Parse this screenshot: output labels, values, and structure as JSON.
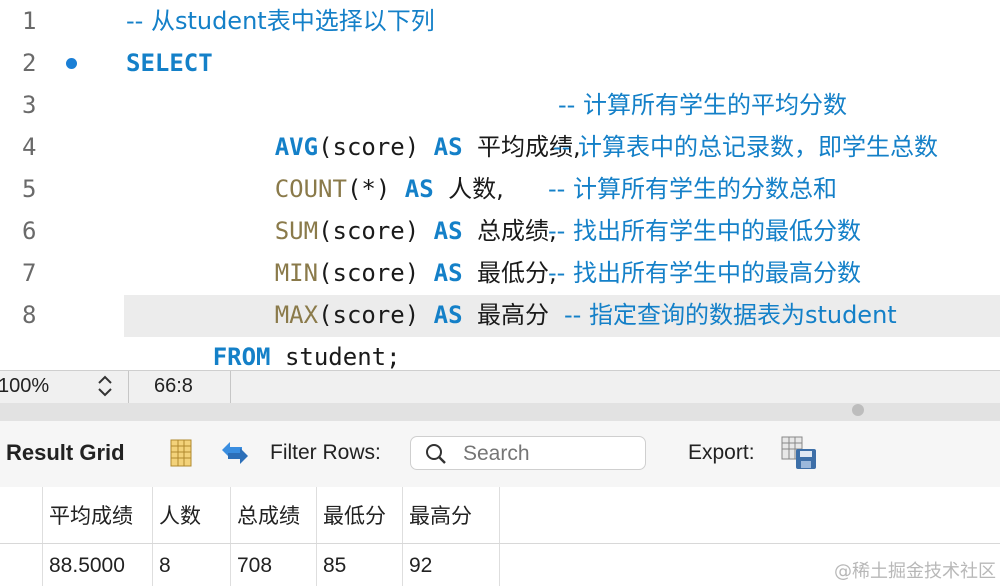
{
  "editor": {
    "lines": [
      {
        "num": "1",
        "comment": "-- 从student表中选择以下列"
      },
      {
        "num": "2",
        "kw": "SELECT"
      },
      {
        "num": "3",
        "fn": "AVG",
        "args": "(score)",
        "as": "AS",
        "alias": "平均成绩,",
        "comment": "-- 计算所有学生的平均分数"
      },
      {
        "num": "4",
        "fn": "COUNT",
        "args": "(*)",
        "as": "AS",
        "alias": "人数,",
        "comment": "-- 计算表中的总记录数，即学生总数"
      },
      {
        "num": "5",
        "fn": "SUM",
        "args": "(score)",
        "as": "AS",
        "alias": "总成绩,",
        "comment": "-- 计算所有学生的分数总和"
      },
      {
        "num": "6",
        "fn": "MIN",
        "args": "(score)",
        "as": "AS",
        "alias": "最低分,",
        "comment": "-- 找出所有学生中的最低分数"
      },
      {
        "num": "7",
        "fn": "MAX",
        "args": "(score)",
        "as": "AS",
        "alias": "最高分",
        "comment": "-- 找出所有学生中的最高分数"
      },
      {
        "num": "8",
        "kw": "FROM",
        "rest": " student;",
        "comment": "-- 指定查询的数据表为student"
      }
    ]
  },
  "statusbar": {
    "zoom": "100%",
    "cursor_pos": "66:8"
  },
  "toolbar": {
    "result_grid_label": "Result Grid",
    "filter_rows_label": "Filter Rows:",
    "search_placeholder": "Search",
    "export_label": "Export:"
  },
  "grid": {
    "columns": [
      "平均成绩",
      "人数",
      "总成绩",
      "最低分",
      "最高分"
    ],
    "rows": [
      [
        "88.5000",
        "8",
        "708",
        "85",
        "92"
      ]
    ]
  },
  "watermark": "@稀土掘金技术社区",
  "colors": {
    "keyword": "#1480c8",
    "function": "#8a7a4a",
    "comment": "#1480c8",
    "breakpoint": "#1a7fd6"
  }
}
